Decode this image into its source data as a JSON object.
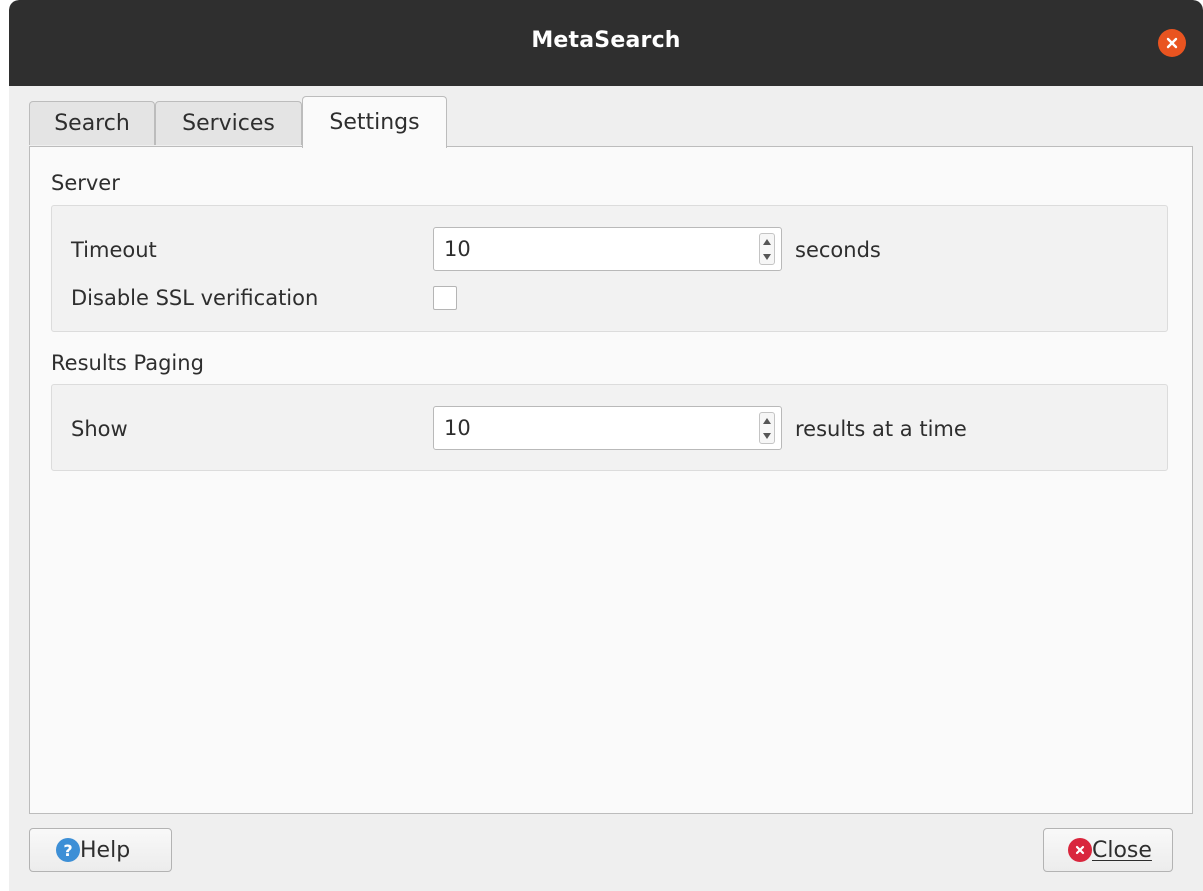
{
  "window": {
    "title": "MetaSearch"
  },
  "tabs": [
    {
      "label": "Search",
      "active": false
    },
    {
      "label": "Services",
      "active": false
    },
    {
      "label": "Settings",
      "active": true
    }
  ],
  "server": {
    "section_label": "Server",
    "timeout_label": "Timeout",
    "timeout_value": "10",
    "timeout_suffix": "seconds",
    "ssl_label": "Disable SSL verification",
    "ssl_checked": false
  },
  "paging": {
    "section_label": "Results Paging",
    "show_label": "Show",
    "show_value": "10",
    "show_suffix": "results at a time"
  },
  "buttons": {
    "help_label": "Help",
    "close_label": "Close"
  },
  "icons": {
    "window_close": "close-icon",
    "help": "help-icon",
    "close": "close-icon"
  },
  "colors": {
    "titlebar": "#2f2f2f",
    "window_close": "#e95420",
    "help_icon": "#3d8fd6",
    "close_icon": "#d9263d"
  }
}
